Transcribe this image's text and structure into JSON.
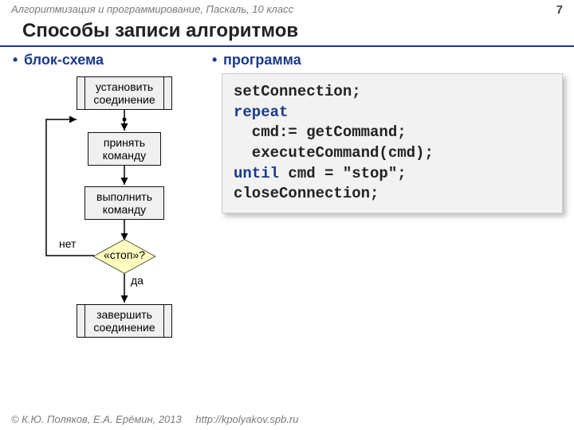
{
  "header": {
    "course": "Алгоритмизация и программирование, Паскаль, 10 класс",
    "page": "7"
  },
  "title": "Способы записи алгоритмов",
  "left_heading": "блок-схема",
  "right_heading": "программа",
  "flowchart": {
    "step1": "установить\nсоединение",
    "step2": "принять\nкоманду",
    "step3": "выполнить\nкоманду",
    "decision": "«стоп»?",
    "no": "нет",
    "yes": "да",
    "step4": "завершить\nсоединение"
  },
  "code": {
    "l1a": "setConnection;",
    "l2a": "repeat",
    "l3a": "  cmd:= getCommand;",
    "l4a": "  executeCommand(cmd);",
    "l5k": "until",
    "l5r": " cmd = \"stop\";",
    "l6a": "closeConnection;"
  },
  "footer": {
    "copyright": "© К.Ю. Поляков, Е.А. Ерёмин, 2013",
    "url": "http://kpolyakov.spb.ru"
  }
}
